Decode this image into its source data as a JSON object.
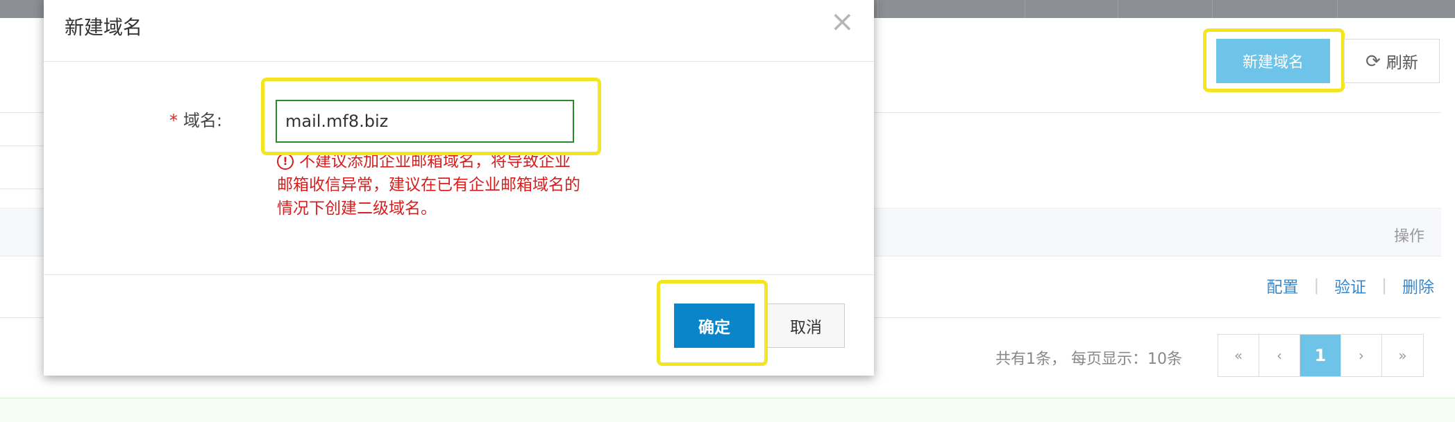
{
  "page": {
    "new_domain_button": "新建域名",
    "refresh_button": "刷新",
    "table": {
      "ops_header": "操作",
      "row_actions": [
        "配置",
        "验证",
        "删除"
      ]
    },
    "pagination": {
      "summary": "共有1条， 每页显示：10条",
      "first": "«",
      "prev": "‹",
      "current": "1",
      "next": "›",
      "last": "»"
    }
  },
  "modal": {
    "title": "新建域名",
    "close": "×",
    "field_label": "域名:",
    "required_mark": "*",
    "domain_value": "mail.mf8.biz",
    "warning_icon": "!",
    "warning_text": "不建议添加企业邮箱域名，将导致企业邮箱收信异常，建议在已有企业邮箱域名的情况下创建二级域名。",
    "confirm_button": "确定",
    "cancel_button": "取消"
  },
  "colors": {
    "primary": "#0a85c9",
    "primary_light": "#6ec3e8",
    "highlight": "#f3e51e",
    "warning": "#d61f1f",
    "link": "#3a87c8"
  }
}
